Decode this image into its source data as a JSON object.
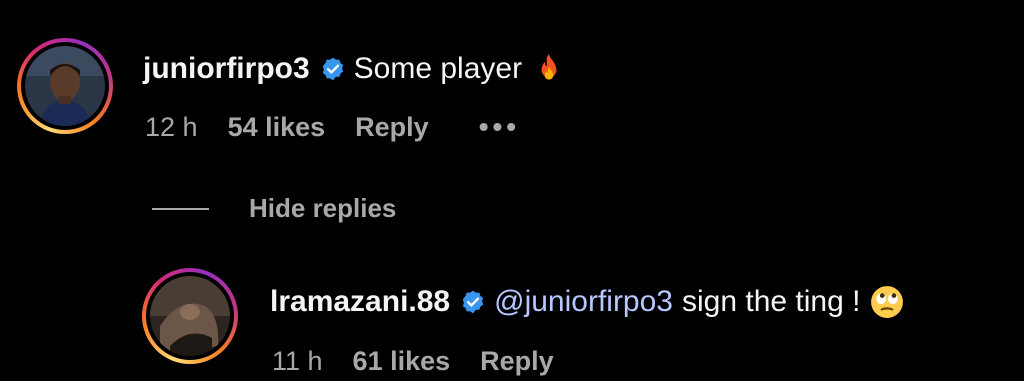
{
  "comments": [
    {
      "username": "juniorfirpo3",
      "verified": true,
      "text": "Some player",
      "emoji": "fire-emoji",
      "time": "12 h",
      "likes": "54 likes",
      "reply": "Reply",
      "more": "•••"
    }
  ],
  "replies_toggle": {
    "label": "Hide replies"
  },
  "replies": [
    {
      "username": "lramazani.88",
      "verified": true,
      "mention": "@juniorfirpo3",
      "text": "sign the ting !",
      "emoji": "eye-roll-emoji",
      "time": "11 h",
      "likes": "61 likes",
      "reply": "Reply"
    }
  ],
  "colors": {
    "background": "#000000",
    "text": "#f5f5f5",
    "muted": "#a8a8a8",
    "verified": "#3797f0",
    "mention": "#b6c8ff"
  }
}
